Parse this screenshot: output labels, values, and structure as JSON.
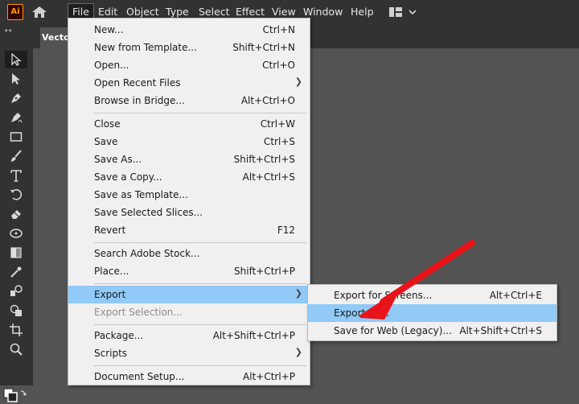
{
  "app": {
    "logo_text": "Ai"
  },
  "menubar": {
    "items": [
      "File",
      "Edit",
      "Object",
      "Type",
      "Select",
      "Effect",
      "View",
      "Window",
      "Help"
    ]
  },
  "document_tab": {
    "title": "Vector"
  },
  "file_menu": {
    "groups": [
      [
        {
          "label": "New...",
          "shortcut": "Ctrl+N"
        },
        {
          "label": "New from Template...",
          "shortcut": "Shift+Ctrl+N"
        },
        {
          "label": "Open...",
          "shortcut": "Ctrl+O"
        },
        {
          "label": "Open Recent Files",
          "submenu": true
        },
        {
          "label": "Browse in Bridge...",
          "shortcut": "Alt+Ctrl+O"
        }
      ],
      [
        {
          "label": "Close",
          "shortcut": "Ctrl+W"
        },
        {
          "label": "Save",
          "shortcut": "Ctrl+S"
        },
        {
          "label": "Save As...",
          "shortcut": "Shift+Ctrl+S"
        },
        {
          "label": "Save a Copy...",
          "shortcut": "Alt+Ctrl+S"
        },
        {
          "label": "Save as Template..."
        },
        {
          "label": "Save Selected Slices..."
        },
        {
          "label": "Revert",
          "shortcut": "F12"
        }
      ],
      [
        {
          "label": "Search Adobe Stock..."
        },
        {
          "label": "Place...",
          "shortcut": "Shift+Ctrl+P"
        }
      ],
      [
        {
          "label": "Export",
          "submenu": true,
          "highlighted": true
        },
        {
          "label": "Export Selection...",
          "disabled": true
        }
      ],
      [
        {
          "label": "Package...",
          "shortcut": "Alt+Shift+Ctrl+P"
        },
        {
          "label": "Scripts",
          "submenu": true
        }
      ],
      [
        {
          "label": "Document Setup...",
          "shortcut": "Alt+Ctrl+P"
        }
      ]
    ]
  },
  "export_submenu": {
    "items": [
      {
        "label": "Export for Screens...",
        "shortcut": "Alt+Ctrl+E"
      },
      {
        "label": "Export As...",
        "highlighted": true
      },
      {
        "label": "Save for Web (Legacy)...",
        "shortcut": "Alt+Shift+Ctrl+S"
      }
    ]
  },
  "colors": {
    "highlight": "#91c9f7",
    "annotation_arrow": "#e8141a",
    "menubar_bg": "#323232",
    "canvas_bg": "#535353"
  },
  "toolbar": {
    "tools": [
      "selection-tool",
      "direct-selection-tool",
      "pen-tool",
      "curvature-tool",
      "rectangle-tool",
      "paintbrush-tool",
      "type-tool",
      "rotate-tool",
      "eraser-tool",
      "width-tool",
      "gradient-tool",
      "eyedropper-tool",
      "blend-tool",
      "shape-builder-tool",
      "artboard-tool",
      "zoom-tool"
    ]
  }
}
